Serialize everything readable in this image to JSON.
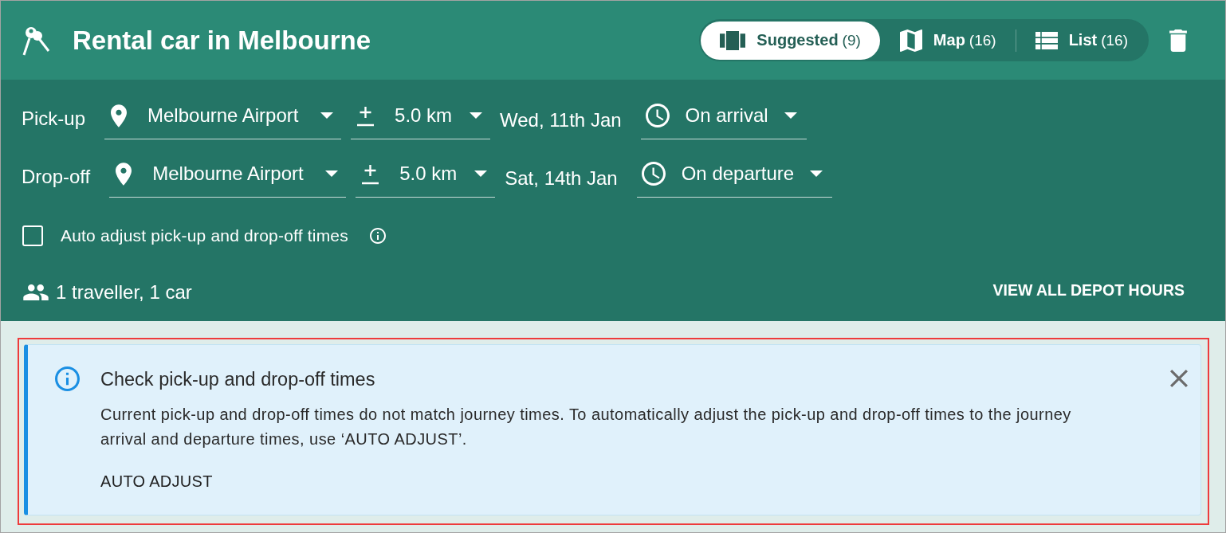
{
  "header": {
    "title": "Rental car in Melbourne",
    "view_tabs": [
      {
        "label": "Suggested",
        "count": "(9)",
        "selected": true
      },
      {
        "label": "Map",
        "count": "(16)",
        "selected": false
      },
      {
        "label": "List",
        "count": "(16)",
        "selected": false
      }
    ]
  },
  "trip": {
    "rows": [
      {
        "label": "Pick-up",
        "location": "Melbourne Airport",
        "radius": "5.0 km",
        "date": "Wed, 11th Jan",
        "time": "On arrival"
      },
      {
        "label": "Drop-off",
        "location": "Melbourne Airport",
        "radius": "5.0 km",
        "date": "Sat, 14th Jan",
        "time": "On departure"
      }
    ],
    "auto_adjust": {
      "label": "Auto adjust pick-up and drop-off times",
      "checked": false
    },
    "travellers": "1 traveller, 1 car",
    "depot_hours_link": "VIEW ALL DEPOT HOURS"
  },
  "alert": {
    "highlighted": true,
    "title": "Check pick-up and drop-off times",
    "message": "Current pick-up and drop-off times do not match journey times. To automatically adjust the pick-up and drop-off times to the journey arrival and departure times, use ‘AUTO ADJUST’.",
    "action": "AUTO ADJUST"
  }
}
